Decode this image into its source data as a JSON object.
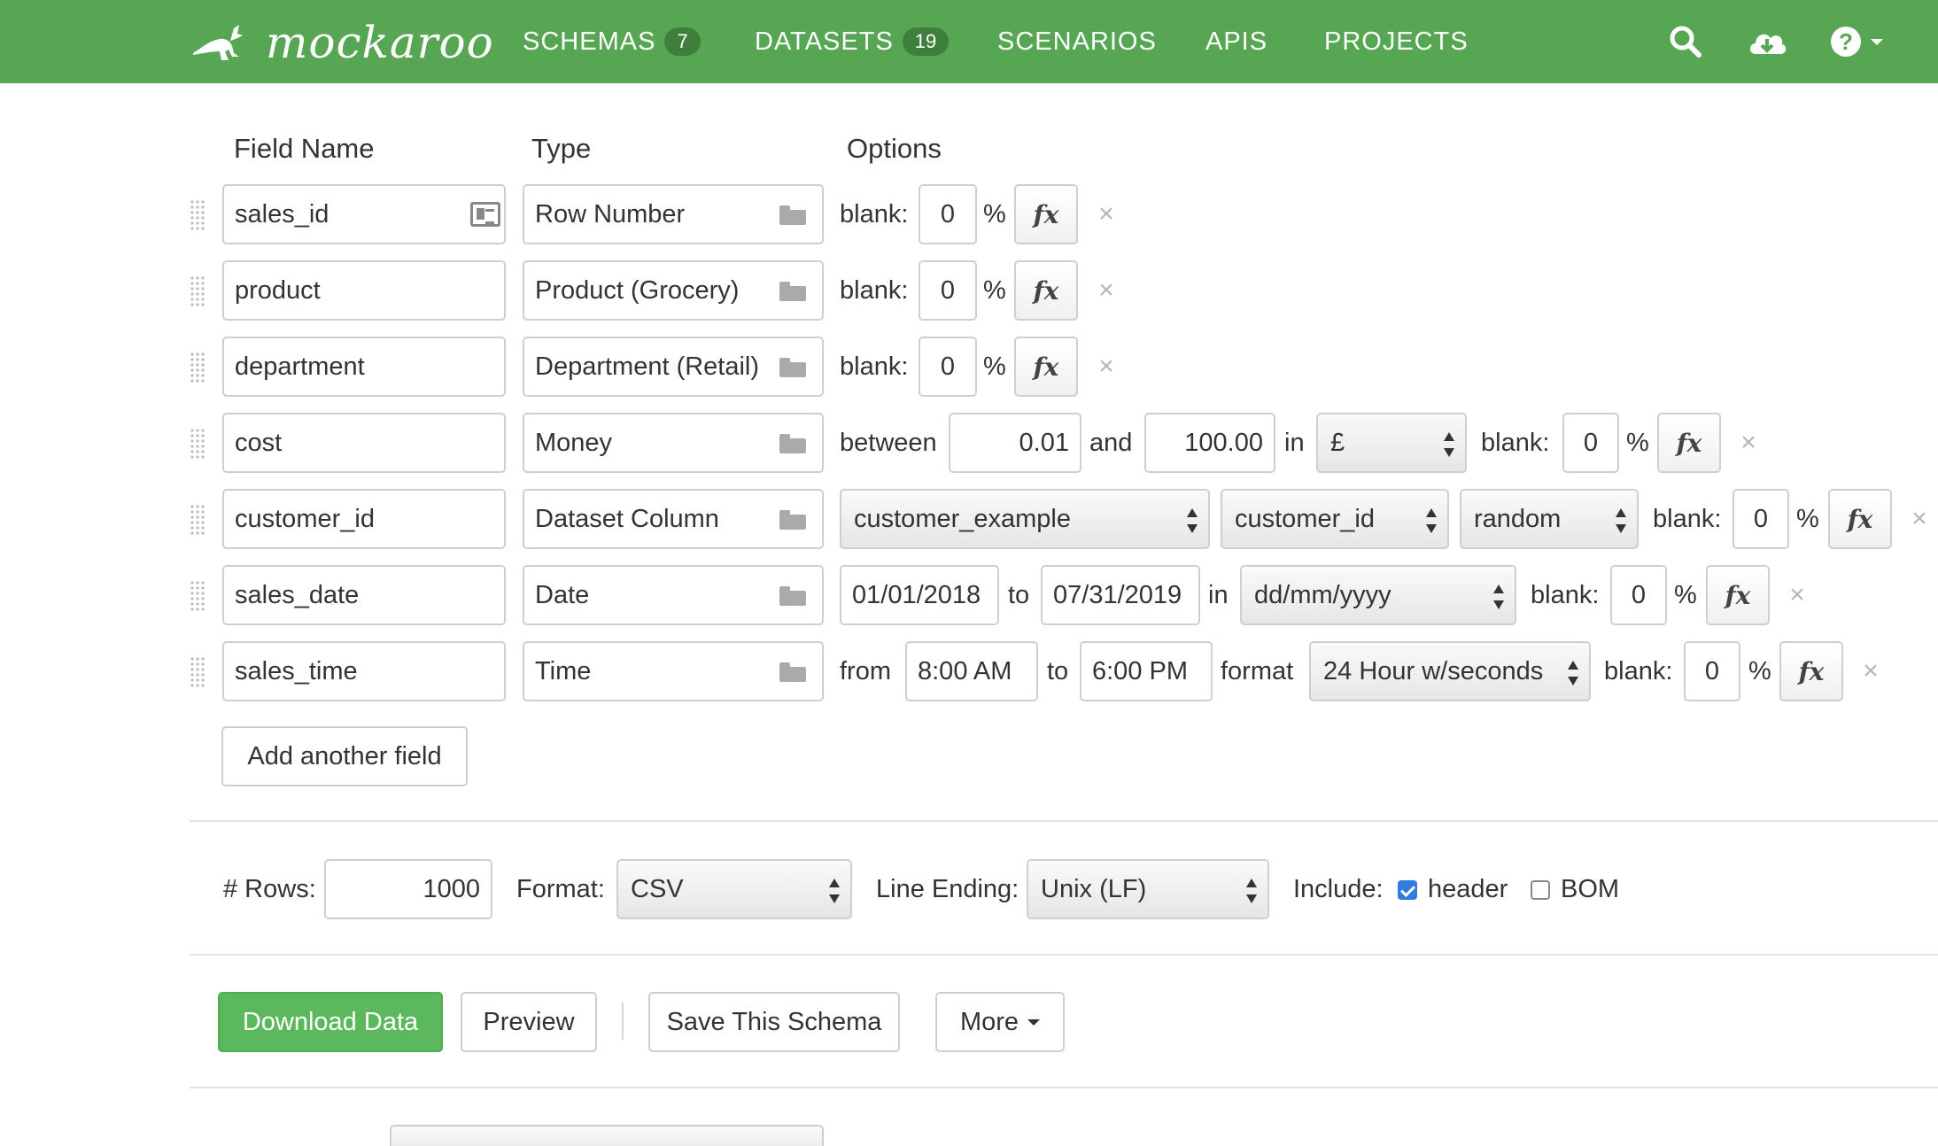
{
  "brand": {
    "name": "mockaroo",
    "logo_icon": "kangaroo-icon",
    "accent_color": "#57a653"
  },
  "nav": {
    "items": [
      {
        "label": "SCHEMAS",
        "badge": "7"
      },
      {
        "label": "DATASETS",
        "badge": "19"
      },
      {
        "label": "SCENARIOS"
      },
      {
        "label": "APIS"
      },
      {
        "label": "PROJECTS"
      }
    ],
    "icons": [
      "search-icon",
      "cloud-download-icon",
      "help-icon"
    ]
  },
  "columns": {
    "field_name": "Field Name",
    "type": "Type",
    "options": "Options"
  },
  "fields": [
    {
      "name": "sales_id",
      "type": "Row Number",
      "blank": "0"
    },
    {
      "name": "product",
      "type": "Product (Grocery)",
      "blank": "0"
    },
    {
      "name": "department",
      "type": "Department (Retail)",
      "blank": "0"
    },
    {
      "name": "cost",
      "type": "Money",
      "between_label": "between",
      "min": "0.01",
      "and_label": "and",
      "max": "100.00",
      "in_label": "in",
      "currency": "£",
      "blank": "0"
    },
    {
      "name": "customer_id",
      "type": "Dataset Column",
      "dataset": "customer_example",
      "column": "customer_id",
      "selection": "random",
      "blank": "0"
    },
    {
      "name": "sales_date",
      "type": "Date",
      "from": "01/01/2018",
      "to_label": "to",
      "to": "07/31/2019",
      "in_label": "in",
      "format": "dd/mm/yyyy",
      "blank": "0"
    },
    {
      "name": "sales_time",
      "type": "Time",
      "from_label": "from",
      "from": "8:00 AM",
      "to_label": "to",
      "to": "6:00 PM",
      "format_label": "format",
      "format": "24 Hour w/seconds",
      "blank": "0"
    }
  ],
  "labels": {
    "blank": "blank:",
    "percent": "%",
    "fx": "fx",
    "remove": "×"
  },
  "add_field_label": "Add another field",
  "settings": {
    "rows_label": "# Rows:",
    "rows": "1000",
    "format_label": "Format:",
    "format": "CSV",
    "line_ending_label": "Line Ending:",
    "line_ending": "Unix (LF)",
    "include_label": "Include:",
    "header_label": "header",
    "header_checked": true,
    "bom_label": "BOM",
    "bom_checked": false
  },
  "actions": {
    "download": "Download Data",
    "preview": "Preview",
    "save": "Save This Schema",
    "more": "More"
  }
}
